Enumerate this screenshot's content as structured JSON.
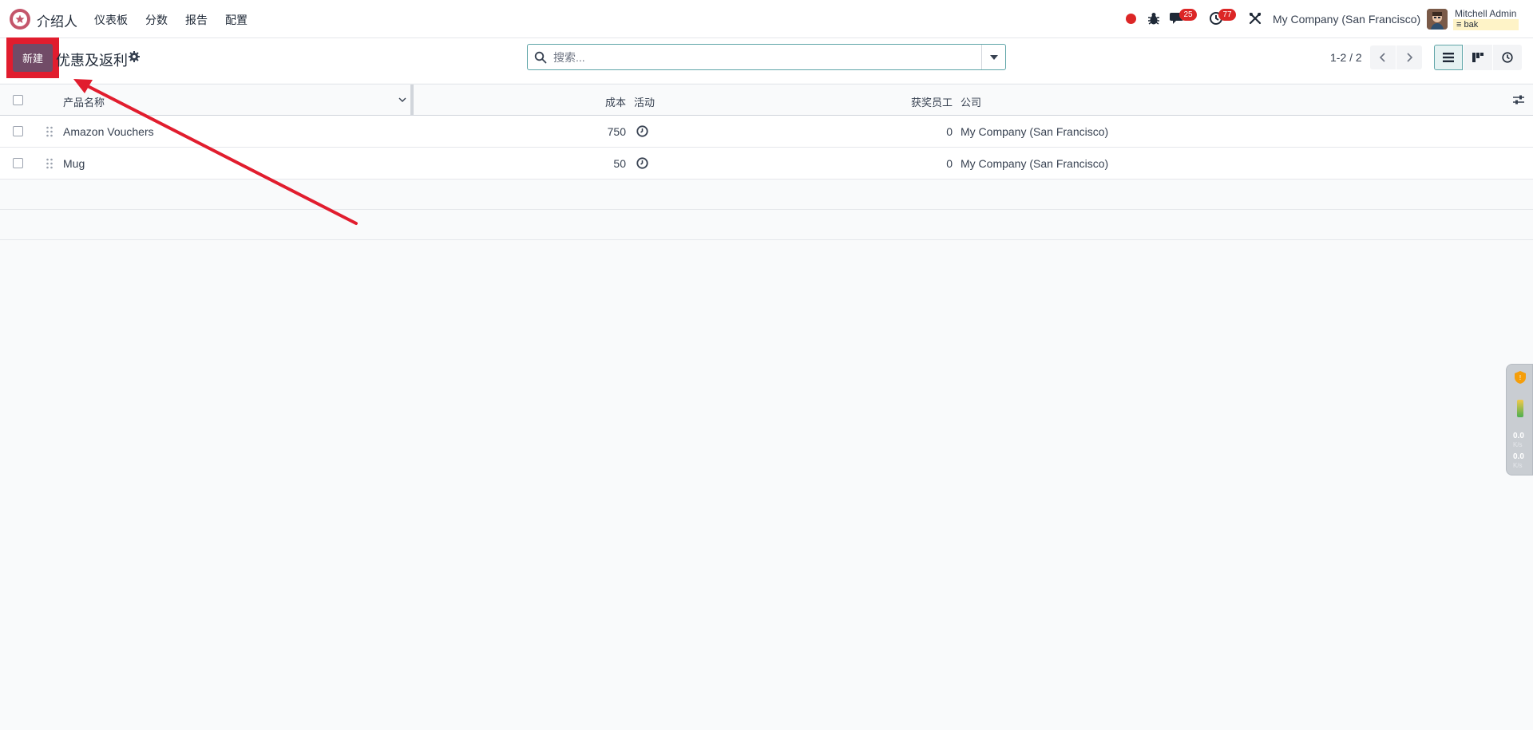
{
  "navbar": {
    "app_name": "介绍人",
    "menu": [
      "仪表板",
      "分数",
      "报告",
      "配置"
    ],
    "messages_count": "25",
    "activities_count": "77",
    "company": "My Company (San Francisco)",
    "user_name": "Mitchell Admin",
    "database": "bak"
  },
  "control_panel": {
    "new_label": "新建",
    "title": "优惠及返利",
    "search_placeholder": "搜索...",
    "pager": "1-2 / 2"
  },
  "list": {
    "headers": {
      "name": "产品名称",
      "cost": "成本",
      "activity": "活动",
      "reward_employees": "获奖员工",
      "company": "公司"
    },
    "rows": [
      {
        "name": "Amazon Vouchers",
        "cost": "750",
        "reward_employees": "0",
        "company": "My Company (San Francisco)"
      },
      {
        "name": "Mug",
        "cost": "50",
        "reward_employees": "0",
        "company": "My Company (San Francisco)"
      }
    ]
  },
  "side_widget": {
    "upload": "0.0",
    "download": "0.0",
    "unit": "K/s"
  },
  "colors": {
    "brand": "#714b67",
    "highlight": "#e11d2e",
    "badge": "#dc2626",
    "accent": "#5fa5a8"
  }
}
